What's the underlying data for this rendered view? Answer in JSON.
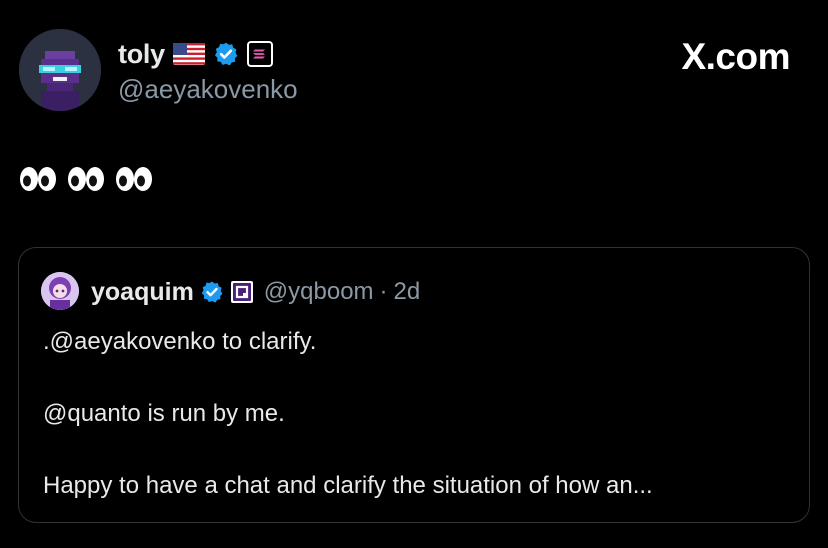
{
  "tweet": {
    "author": {
      "display_name": "toly",
      "handle": "@aeyakovenko",
      "flag_emoji": "🇺🇸",
      "verified": true,
      "affiliate_badge_icon": "solana-badge-icon"
    },
    "text": "👀👀👀"
  },
  "branding": {
    "logo": "X.com"
  },
  "quoted_tweet": {
    "author": {
      "display_name": "yoaquim",
      "handle": "@yqboom",
      "verified": true,
      "affiliate_badge_icon": "square-badge-icon"
    },
    "separator": "·",
    "time": "2d",
    "lines": [
      ".@aeyakovenko to clarify.",
      "@quanto is run by me.",
      "Happy to have a chat and clarify the situation of how an..."
    ]
  },
  "colors": {
    "background": "#000000",
    "text_primary": "#e7e9ea",
    "text_secondary": "#8b98a5",
    "verified_blue": "#1d9bf0",
    "border": "#2f3336"
  }
}
